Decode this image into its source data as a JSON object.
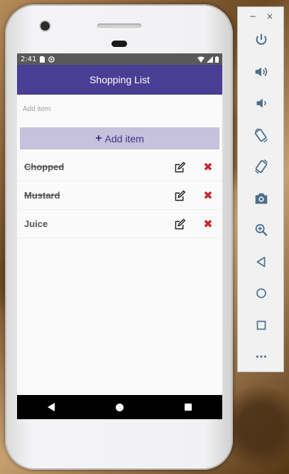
{
  "status_bar": {
    "time": "2:41"
  },
  "app": {
    "title": "Shopping List"
  },
  "input": {
    "placeholder": "Add item",
    "value": ""
  },
  "add_button": {
    "label": "Add item",
    "icon": "plus-icon"
  },
  "items": [
    {
      "name": "Chopped",
      "completed": true
    },
    {
      "name": "Mustard",
      "completed": true
    },
    {
      "name": "Juice",
      "completed": false
    }
  ],
  "colors": {
    "primary": "#4a3d94",
    "button_bg": "#c6c1dc",
    "delete": "#c62828",
    "background": "#fafafa"
  },
  "emulator_toolbar": {
    "window_controls": [
      "−",
      "×"
    ],
    "buttons": [
      "power",
      "volume-up",
      "volume-down",
      "rotate-left",
      "rotate-right",
      "screenshot",
      "zoom",
      "back",
      "home",
      "overview",
      "more"
    ]
  }
}
